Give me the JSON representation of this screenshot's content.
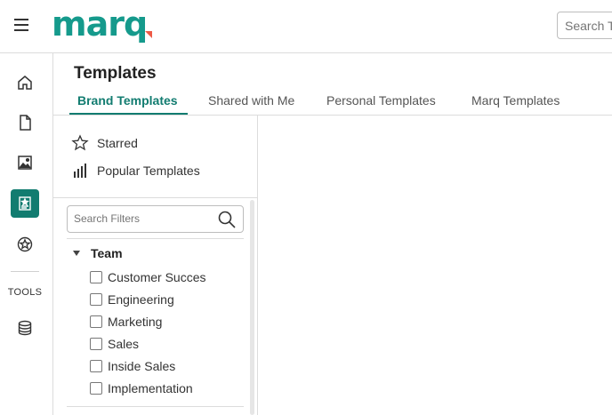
{
  "app": {
    "logo_text": "marq",
    "search_placeholder": "Search T"
  },
  "rail": {
    "tools_label": "TOOLS",
    "items": [
      {
        "icon": "home-icon"
      },
      {
        "icon": "document-icon"
      },
      {
        "icon": "image-icon"
      },
      {
        "icon": "templates-icon",
        "active": true
      },
      {
        "icon": "brand-badge-icon"
      },
      {
        "icon": "database-icon"
      }
    ]
  },
  "page": {
    "title": "Templates"
  },
  "tabs": [
    {
      "label": "Brand Templates",
      "active": true
    },
    {
      "label": "Shared with Me"
    },
    {
      "label": "Personal Templates"
    },
    {
      "label": "Marq Templates"
    }
  ],
  "panel": {
    "quick_links": [
      {
        "label": "Starred",
        "icon": "star-icon"
      },
      {
        "label": "Popular Templates",
        "icon": "bar-chart-icon"
      }
    ],
    "filter_search_placeholder": "Search Filters",
    "group": {
      "label": "Team",
      "options": [
        {
          "label": "Customer Succes",
          "checked": false
        },
        {
          "label": "Engineering",
          "checked": false
        },
        {
          "label": "Marketing",
          "checked": false
        },
        {
          "label": "Sales",
          "checked": false
        },
        {
          "label": "Inside Sales",
          "checked": false
        },
        {
          "label": "Implementation",
          "checked": false
        }
      ]
    }
  },
  "colors": {
    "brand_teal": "#127c70",
    "logo_teal": "#159a8c",
    "logo_accent": "#ee5a46"
  }
}
